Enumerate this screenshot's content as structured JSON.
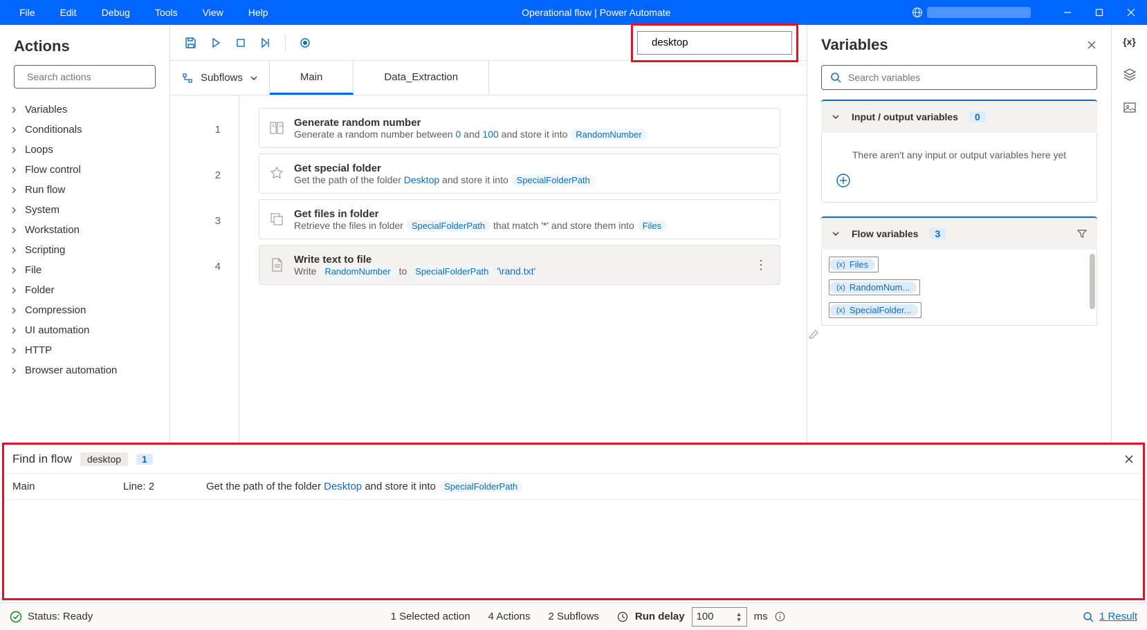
{
  "titleBar": {
    "menus": [
      "File",
      "Edit",
      "Debug",
      "Tools",
      "View",
      "Help"
    ],
    "title": "Operational flow | Power Automate"
  },
  "actionsPanel": {
    "heading": "Actions",
    "searchPlaceholder": "Search actions",
    "categories": [
      "Variables",
      "Conditionals",
      "Loops",
      "Flow control",
      "Run flow",
      "System",
      "Workstation",
      "Scripting",
      "File",
      "Folder",
      "Compression",
      "UI automation",
      "HTTP",
      "Browser automation"
    ]
  },
  "toolbar": {
    "searchValue": "desktop"
  },
  "subflows": {
    "label": "Subflows",
    "tabs": [
      "Main",
      "Data_Extraction"
    ],
    "active": 0
  },
  "steps": [
    {
      "title": "Generate random number",
      "descParts": [
        "Generate a random number between ",
        {
          "hl": "0"
        },
        " and ",
        {
          "hl": "100"
        },
        " and store it into "
      ],
      "endVar": "RandomNumber"
    },
    {
      "title": "Get special folder",
      "descParts": [
        "Get the path of the folder ",
        {
          "hl": "Desktop"
        },
        " and store it into "
      ],
      "endVar": "SpecialFolderPath"
    },
    {
      "title": "Get files in folder",
      "descParts": [
        "Retrieve the files in folder "
      ],
      "midVar": "SpecialFolderPath",
      "descParts2": [
        " that match ",
        {
          "hl": "'*'"
        },
        " and store them into "
      ],
      "endVar": "Files"
    },
    {
      "title": "Write text to file",
      "descParts": [
        "Write "
      ],
      "midVar": "RandomNumber",
      "descParts2": [
        " to "
      ],
      "midVar2": "SpecialFolderPath",
      "descParts3": [
        {
          "hl": " '\\rand.txt'"
        }
      ],
      "selected": true
    }
  ],
  "variablesPanel": {
    "heading": "Variables",
    "searchPlaceholder": "Search variables",
    "ioSection": {
      "title": "Input / output variables",
      "count": "0",
      "empty": "There aren't any input or output variables here yet"
    },
    "flowSection": {
      "title": "Flow variables",
      "count": "3",
      "vars": [
        "Files",
        "RandomNum...",
        "SpecialFolder..."
      ]
    }
  },
  "findPanel": {
    "title": "Find in flow",
    "keyword": "desktop",
    "count": "1",
    "result": {
      "subflow": "Main",
      "line": "Line: 2",
      "desc1": "Get the path of the folder ",
      "hl": "Desktop",
      "desc2": " and store it into ",
      "var": "SpecialFolderPath"
    }
  },
  "statusBar": {
    "status": "Status: Ready",
    "selected": "1 Selected action",
    "actions": "4 Actions",
    "subflows": "2 Subflows",
    "runDelayLabel": "Run delay",
    "runDelayValue": "100",
    "runDelayUnit": "ms",
    "result": "1 Result"
  }
}
